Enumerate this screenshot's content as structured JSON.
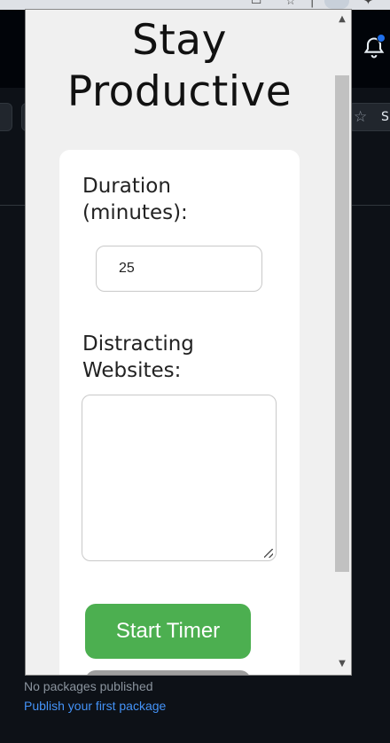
{
  "popup": {
    "title": "Stay Productive",
    "duration": {
      "label": "Duration (minutes):",
      "value": "25"
    },
    "websites": {
      "label": "Distracting Websites:",
      "value": ""
    },
    "start_button": "Start Timer"
  },
  "background": {
    "packages_text": "No packages published",
    "packages_link": "Publish your first package",
    "star_label": "S"
  },
  "icons": {
    "bell": "bell-icon",
    "star": "star-icon",
    "scroll_up": "scroll-up-icon",
    "scroll_down": "scroll-down-icon"
  },
  "colors": {
    "start_button": "#4caf50",
    "link": "#4493f8",
    "notification_dot": "#1f6feb"
  }
}
